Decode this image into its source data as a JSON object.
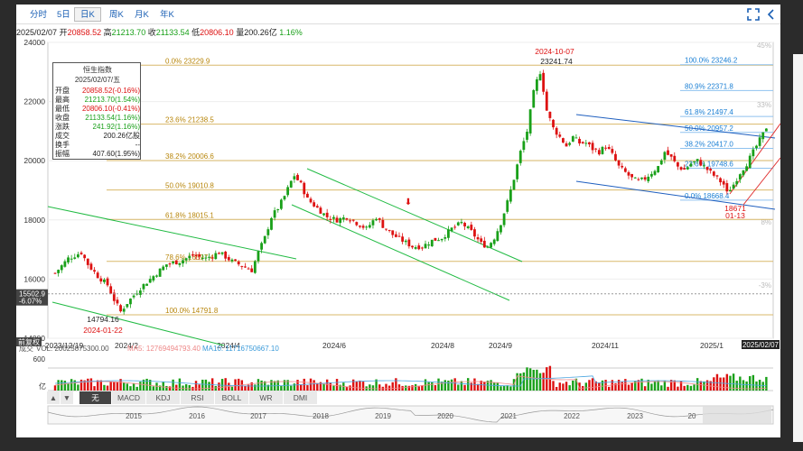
{
  "tabs": [
    "分时",
    "5日",
    "日K",
    "周K",
    "月K",
    "年K"
  ],
  "active_tab": "日K",
  "info": {
    "date": "2025/02/07",
    "open_label": "开",
    "open": "20858.52",
    "high_label": "高",
    "high": "21213.70",
    "close_label": "收",
    "close": "21133.54",
    "low_label": "低",
    "low": "20806.10",
    "amount_label": "量",
    "amount": "200.26亿",
    "change": "1.16%"
  },
  "ohlc_box": {
    "title": "恒生指数",
    "date": "2025/02/07/五",
    "rows": [
      {
        "k": "开盘",
        "v": "20858.52(-0.16%)",
        "color": "red"
      },
      {
        "k": "最高",
        "v": "21213.70(1.54%)",
        "color": "green"
      },
      {
        "k": "最低",
        "v": "20806.10(-0.41%)",
        "color": "red"
      },
      {
        "k": "收盘",
        "v": "21133.54(1.16%)",
        "color": "green"
      },
      {
        "k": "涨跌",
        "v": "241.92(1.16%)",
        "color": "green"
      },
      {
        "k": "成交",
        "v": "200.26亿股",
        "color": "dark"
      },
      {
        "k": "换手",
        "v": "--",
        "color": "dark"
      },
      {
        "k": "振幅",
        "v": "407.60(1.95%)",
        "color": "dark"
      }
    ]
  },
  "cursor": {
    "price": "15502.9",
    "pct": "-6.07%",
    "axis_label": "前复权"
  },
  "last_date_label": "2025/02/07",
  "volume": {
    "label": "成交",
    "vol_label": "VOL: 20025875300.00",
    "ma5_label": "MA5: 12769494793.40",
    "ma10_label": "MA10: 11716750667.10",
    "ytick": "600",
    "unit_label": "亿"
  },
  "indicators": [
    "无",
    "MACD",
    "KDJ",
    "RSI",
    "BOLL",
    "WR",
    "DMI"
  ],
  "active_indicator": "无",
  "navigator_years": [
    "2015",
    "2016",
    "2017",
    "2018",
    "2019",
    "2020",
    "2021",
    "2022",
    "2023",
    "20"
  ],
  "colors": {
    "up": "#19a019",
    "down": "#d11",
    "fib_left": "#b8860b",
    "fib_right": "#1a7fd4",
    "channel": "#22bb44",
    "channel_blue": "#1f5fbf",
    "right_channel": "#e03030"
  },
  "chart_data": {
    "type": "candlestick",
    "y_ticks": [
      24000,
      22000,
      20000,
      18000,
      16000,
      14000
    ],
    "ylim": [
      14000,
      24000
    ],
    "right_pct_ticks": [
      "45%",
      "33%",
      "8%",
      "-3%"
    ],
    "x_ticks": [
      "2023/12/19",
      "2024/2",
      "2024/4",
      "2024/6",
      "2024/8",
      "2024/9",
      "2024/11",
      "2025/1"
    ],
    "fib_left": [
      {
        "label": "0.0% 23229.9",
        "y": 23229.9
      },
      {
        "label": "23.6% 21238.5",
        "y": 21238.5
      },
      {
        "label": "38.2% 20006.6",
        "y": 20006.6
      },
      {
        "label": "50.0% 19010.8",
        "y": 19010.8
      },
      {
        "label": "61.8% 18015.1",
        "y": 18015.1
      },
      {
        "label": "78.6% 16597.4",
        "y": 16597.4
      },
      {
        "label": "100.0% 14791.8",
        "y": 14791.8
      }
    ],
    "fib_right": [
      {
        "label": "100.0% 23246.2",
        "y": 23246.2
      },
      {
        "label": "80.9% 22371.8",
        "y": 22371.8
      },
      {
        "label": "61.8% 21497.4",
        "y": 21497.4
      },
      {
        "label": "50.0% 20957.2",
        "y": 20957.2
      },
      {
        "label": "38.2% 20417.0",
        "y": 20417.0
      },
      {
        "label": "23.6% 19748.6",
        "y": 19748.6
      },
      {
        "label": "0.0% 18668.4",
        "y": 18668.4
      }
    ],
    "annotations": [
      {
        "text": "2024-10-07",
        "color": "red"
      },
      {
        "text": "23241.74",
        "color": "dark"
      },
      {
        "text": "14794.16",
        "color": "dark"
      },
      {
        "text": "2024-01-22",
        "color": "red"
      },
      {
        "text": "18671",
        "color": "red"
      },
      {
        "text": "01-13",
        "color": "red"
      }
    ],
    "price_path": [
      [
        0,
        16200
      ],
      [
        4,
        16700
      ],
      [
        8,
        16900
      ],
      [
        10,
        16500
      ],
      [
        13,
        16100
      ],
      [
        16,
        15800
      ],
      [
        18,
        15300
      ],
      [
        20,
        14900
      ],
      [
        22,
        15200
      ],
      [
        26,
        15700
      ],
      [
        30,
        16100
      ],
      [
        34,
        16500
      ],
      [
        38,
        16600
      ],
      [
        42,
        16800
      ],
      [
        46,
        16700
      ],
      [
        50,
        16900
      ],
      [
        54,
        16600
      ],
      [
        58,
        16400
      ],
      [
        60,
        16300
      ],
      [
        62,
        16900
      ],
      [
        64,
        17400
      ],
      [
        66,
        18100
      ],
      [
        68,
        18400
      ],
      [
        70,
        18800
      ],
      [
        72,
        19300
      ],
      [
        73,
        19500
      ],
      [
        75,
        19200
      ],
      [
        77,
        18700
      ],
      [
        80,
        18400
      ],
      [
        83,
        18100
      ],
      [
        86,
        18000
      ],
      [
        89,
        18100
      ],
      [
        92,
        17900
      ],
      [
        95,
        17700
      ],
      [
        98,
        18100
      ],
      [
        100,
        17800
      ],
      [
        103,
        17500
      ],
      [
        106,
        17300
      ],
      [
        109,
        17100
      ],
      [
        112,
        17100
      ],
      [
        115,
        17300
      ],
      [
        118,
        17400
      ],
      [
        121,
        17700
      ],
      [
        124,
        17900
      ],
      [
        127,
        17600
      ],
      [
        130,
        17200
      ],
      [
        132,
        17100
      ],
      [
        134,
        17400
      ],
      [
        136,
        17900
      ],
      [
        138,
        18600
      ],
      [
        140,
        19400
      ],
      [
        142,
        20300
      ],
      [
        144,
        21000
      ],
      [
        146,
        22300
      ],
      [
        147,
        22700
      ],
      [
        148,
        23000
      ],
      [
        149,
        22400
      ],
      [
        150,
        21700
      ],
      [
        152,
        21100
      ],
      [
        154,
        20800
      ],
      [
        156,
        20500
      ],
      [
        158,
        20800
      ],
      [
        160,
        20600
      ],
      [
        162,
        20600
      ],
      [
        164,
        20400
      ],
      [
        166,
        20300
      ],
      [
        168,
        20500
      ],
      [
        170,
        20200
      ],
      [
        172,
        19800
      ],
      [
        174,
        19600
      ],
      [
        176,
        19400
      ],
      [
        178,
        19300
      ],
      [
        180,
        19400
      ],
      [
        182,
        19600
      ],
      [
        184,
        19800
      ],
      [
        186,
        20300
      ],
      [
        188,
        20100
      ],
      [
        190,
        19800
      ],
      [
        192,
        19700
      ],
      [
        194,
        19900
      ],
      [
        196,
        20000
      ],
      [
        198,
        19800
      ],
      [
        200,
        19600
      ],
      [
        202,
        19400
      ],
      [
        204,
        19200
      ],
      [
        205,
        18900
      ],
      [
        207,
        19200
      ],
      [
        209,
        19600
      ],
      [
        211,
        19900
      ],
      [
        213,
        20300
      ],
      [
        215,
        20700
      ],
      [
        216,
        20900
      ],
      [
        217,
        21133
      ]
    ]
  }
}
